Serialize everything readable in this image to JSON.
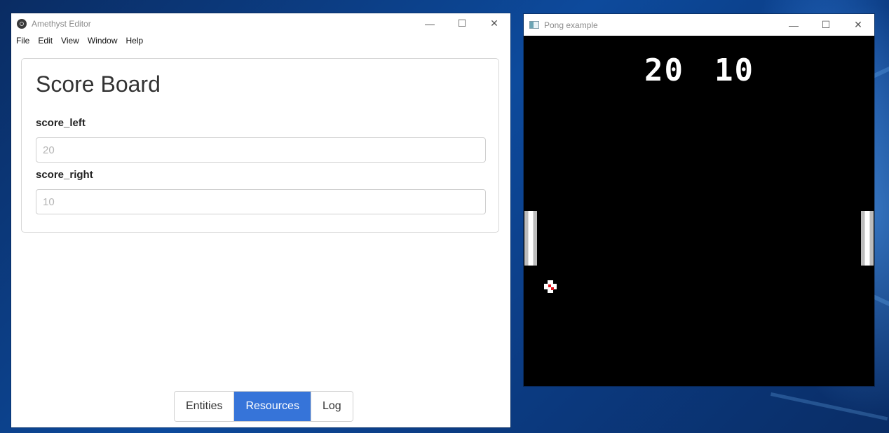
{
  "editor": {
    "title": "Amethyst Editor",
    "menu": [
      "File",
      "Edit",
      "View",
      "Window",
      "Help"
    ],
    "card_title": "Score Board",
    "fields": [
      {
        "label": "score_left",
        "placeholder": "20"
      },
      {
        "label": "score_right",
        "placeholder": "10"
      }
    ],
    "tabs": [
      {
        "label": "Entities",
        "active": false
      },
      {
        "label": "Resources",
        "active": true
      },
      {
        "label": "Log",
        "active": false
      }
    ],
    "controls": {
      "minimize": "—",
      "maximize": "☐",
      "close": "✕"
    }
  },
  "pong": {
    "title": "Pong example",
    "score_left": "20",
    "score_right": "10",
    "controls": {
      "minimize": "—",
      "maximize": "☐",
      "close": "✕"
    }
  },
  "colors": {
    "accent": "#3674d9",
    "desktop": "#0d4a9c",
    "ball_center": "#e0141c"
  }
}
